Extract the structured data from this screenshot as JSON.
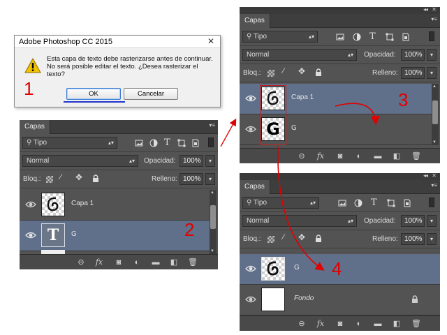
{
  "dialog": {
    "title": "Adobe Photoshop CC 2015",
    "message": "Esta capa de texto debe rasterizarse antes de continuar. No será posible editar el texto. ¿Desea rasterizar el texto?",
    "ok_label": "OK",
    "cancel_label": "Cancelar",
    "close_glyph": "✕"
  },
  "panels": {
    "tab_label": "Capas",
    "filter_label": "Tipo",
    "blend_mode": "Normal",
    "opacity_label": "Opacidad:",
    "opacity_value": "100%",
    "lock_label": "Bloq.:",
    "fill_label": "Relleno:",
    "fill_value": "100%"
  },
  "panel2": {
    "layers": [
      {
        "name": "Capa 1",
        "thumb": "swirl"
      },
      {
        "name": "G",
        "thumb": "text-T"
      }
    ]
  },
  "panel3": {
    "layers": [
      {
        "name": "Capa 1",
        "thumb": "swirl"
      },
      {
        "name": "G",
        "thumb": "G"
      }
    ]
  },
  "panel4": {
    "layers": [
      {
        "name": "G",
        "thumb": "swirl-G"
      },
      {
        "name": "Fondo",
        "thumb": "white"
      }
    ]
  },
  "annotations": [
    "1",
    "2",
    "3",
    "4"
  ],
  "glyphs": {
    "text_thumb": "T",
    "g_thumb": "G",
    "fx": "fx",
    "collapse": "◂◂",
    "close": "✕"
  },
  "colors": {
    "annotation": "#e00000",
    "active_layer": "#60708a",
    "panel_bg": "#535353"
  }
}
